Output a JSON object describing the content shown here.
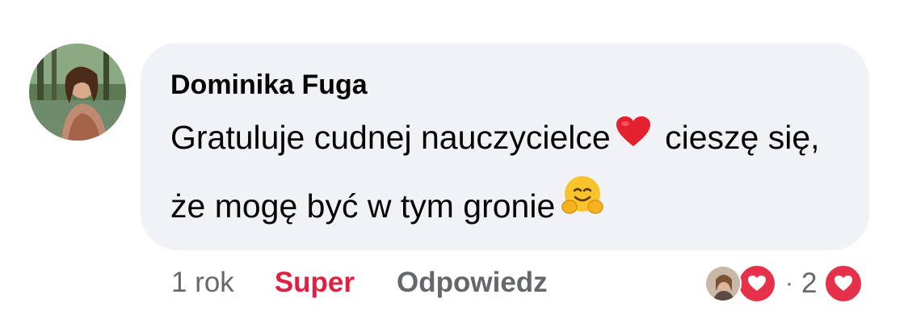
{
  "comment": {
    "author": "Dominika Fuga",
    "text_part1": "Gratuluje cudnej nauczycielce",
    "text_part2": "cieszę się, że mogę być w tym gronie",
    "emoji_1": "red-heart",
    "emoji_2": "hugging-face"
  },
  "actions": {
    "timestamp": "1 rok",
    "react_label": "Super",
    "reply_label": "Odpowiedz"
  },
  "reactions": {
    "separator": "·",
    "count": "2",
    "reaction_type": "love"
  },
  "colors": {
    "bubble_bg": "#f0f2f5",
    "love_red": "#e41e3f",
    "muted_text": "#65676b"
  }
}
